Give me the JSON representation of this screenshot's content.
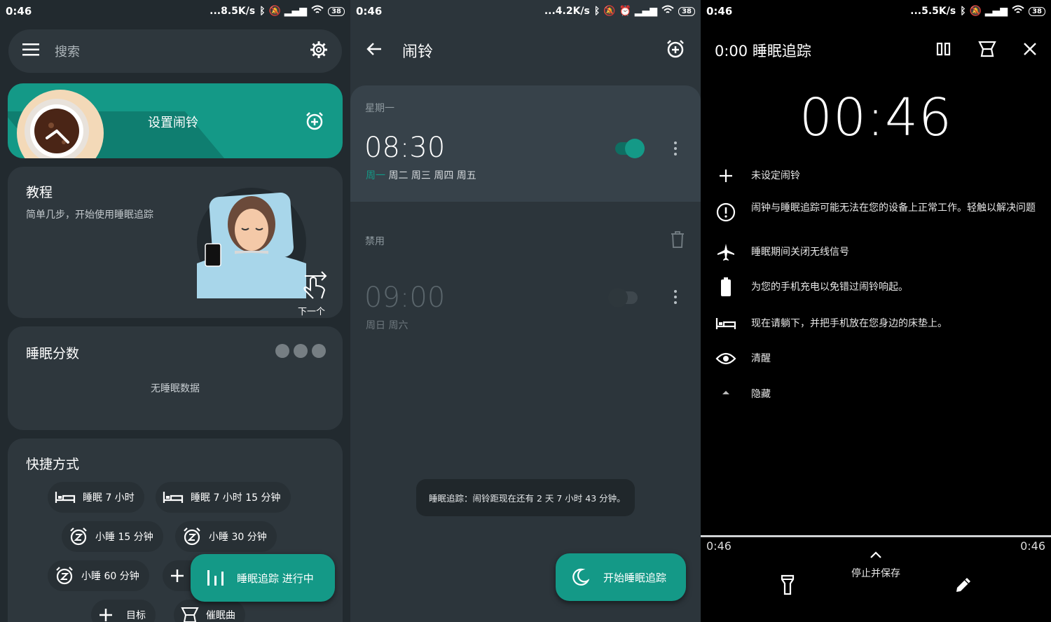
{
  "panel1": {
    "status": {
      "time": "0:46",
      "speed": "...8.5K/s",
      "battery": "38"
    },
    "search": {
      "placeholder": "搜索"
    },
    "alarm_card": {
      "label": "设置闹铃"
    },
    "tutorial": {
      "title": "教程",
      "subtitle": "简单几步，开始使用睡眠追踪",
      "next": "下一个"
    },
    "score": {
      "title": "睡眠分数",
      "empty": "无睡眠数据"
    },
    "shortcuts": {
      "title": "快捷方式",
      "items": [
        "睡眠 7 小时",
        "睡眠 7 小时 15 分钟",
        "小睡 15 分钟",
        "小睡 30 分钟",
        "小睡 60 分钟",
        "目标",
        "催眠曲"
      ]
    },
    "fab": {
      "label": "睡眠追踪 进行中"
    }
  },
  "panel2": {
    "status": {
      "time": "0:46",
      "speed": "...4.2K/s",
      "battery": "38"
    },
    "header": {
      "title": "闹铃"
    },
    "alarm1": {
      "group": "星期一",
      "time": "08:30",
      "day_active": "周一",
      "days_rest": "周二 周三 周四 周五"
    },
    "disabled_label": "禁用",
    "alarm2": {
      "time": "09:00",
      "days": "周日 周六"
    },
    "toast": "睡眠追踪：闹铃距现在还有 2 天 7 小时 43 分钟。",
    "fab": {
      "label": "开始睡眠追踪"
    },
    "colors": {
      "accent": "#149987"
    }
  },
  "panel3": {
    "status": {
      "time": "0:46",
      "speed": "...5.5K/s",
      "battery": "38"
    },
    "header": {
      "title": "0:00 睡眠追踪"
    },
    "clock": "00:46",
    "rows": [
      {
        "icon": "plus-icon",
        "text": "未设定闹铃"
      },
      {
        "icon": "warning-icon",
        "text": "闹钟与睡眠追踪可能无法在您的设备上正常工作。轻触以解决问题"
      },
      {
        "icon": "airplane-icon",
        "text": "睡眠期间关闭无线信号"
      },
      {
        "icon": "battery-icon",
        "text": "为您的手机充电以免错过闹铃响起。"
      },
      {
        "icon": "bed-icon",
        "text": "现在请躺下，并把手机放在您身边的床垫上。"
      },
      {
        "icon": "eye-icon",
        "text": "清醒"
      },
      {
        "icon": "triangle-up-icon",
        "text": "隐藏"
      }
    ],
    "timeline": {
      "start": "0:46",
      "end": "0:46"
    },
    "stop_save": "停止并保存"
  }
}
